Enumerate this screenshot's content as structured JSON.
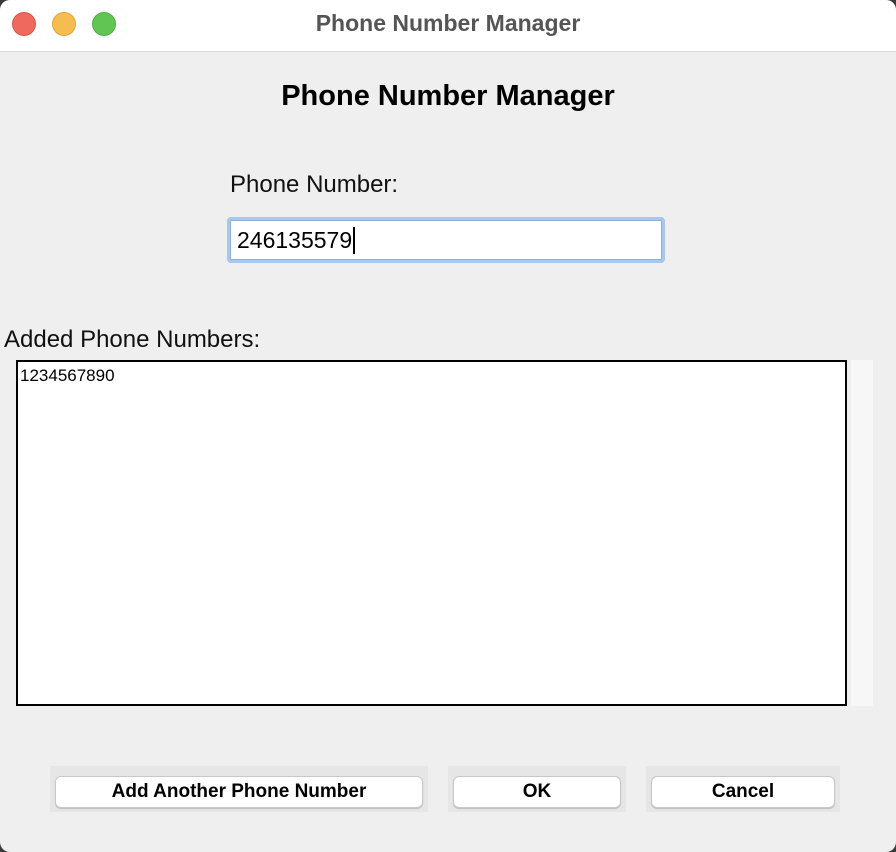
{
  "window": {
    "title": "Phone Number Manager"
  },
  "main": {
    "heading": "Phone Number Manager",
    "phone_label": "Phone Number:",
    "phone_value": "246135579",
    "list_label": "Added Phone Numbers:",
    "list_items": [
      "1234567890"
    ]
  },
  "buttons": {
    "add_another": "Add Another Phone Number",
    "ok": "OK",
    "cancel": "Cancel"
  }
}
